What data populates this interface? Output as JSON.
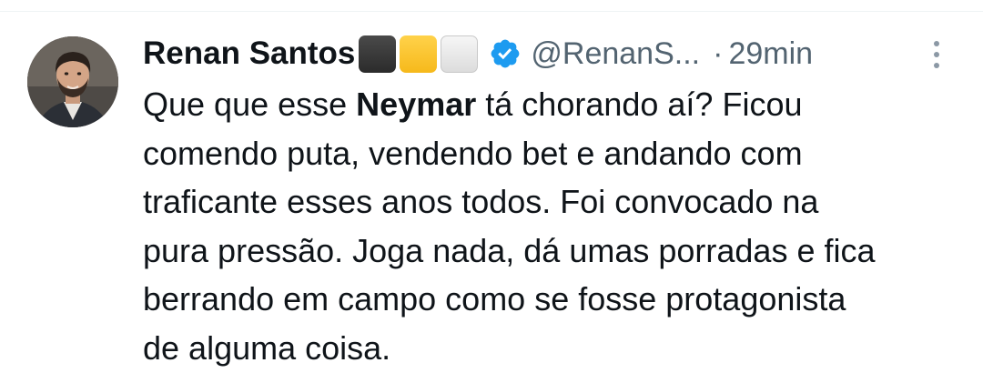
{
  "tweet": {
    "author": {
      "display_name": "Renan Santos",
      "name_emojis": [
        "black-large-square",
        "yellow-large-square",
        "white-large-square"
      ],
      "verified": true,
      "verified_color": "#1d9bf0",
      "handle": "@RenanS...",
      "separator": "·",
      "time": "29min",
      "avatar_icon": "profile-photo"
    },
    "more_icon": "more-vertical-icon",
    "body": {
      "line1_pre": "Que que esse ",
      "line1_bold": "Neymar",
      "line1_post": " tá chorando aí? Ficou",
      "line2": "comendo puta, vendendo bet e andando com",
      "line3": "traficante esses anos todos. Foi convocado na",
      "line4": "pura pressão. Joga nada, dá umas porradas e fica",
      "line5": "berrando em campo como se fosse protagonista",
      "line6": "de alguma coisa."
    }
  }
}
